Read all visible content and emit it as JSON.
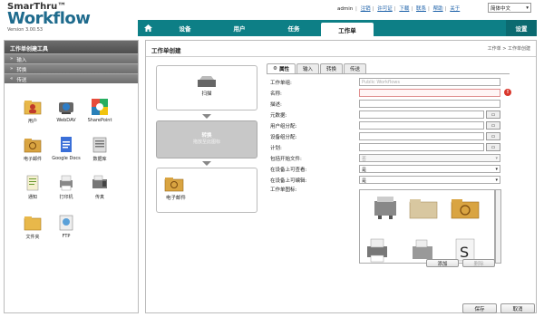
{
  "header": {
    "logo_line1": "SmarThru™",
    "logo_line2": "Workflow",
    "version": "Version 3.00.53",
    "user": "admin",
    "links": [
      "注销",
      "许可证",
      "下载",
      "联系",
      "帮助",
      "关于"
    ],
    "language": "简体中文"
  },
  "nav": {
    "items": [
      "设备",
      "用户",
      "任务",
      "工作单"
    ],
    "active": "工作单",
    "settings": "设置"
  },
  "left_panel": {
    "title": "工作单创建工具",
    "sections": [
      "输入",
      "转换",
      "传送"
    ],
    "tools": [
      {
        "label": "用户",
        "icon": "user-folder-icon"
      },
      {
        "label": "WebDAV",
        "icon": "webdav-icon"
      },
      {
        "label": "SharePoint",
        "icon": "sharepoint-icon"
      },
      {
        "label": "电子邮件",
        "icon": "email-icon"
      },
      {
        "label": "Google Docs",
        "icon": "google-docs-icon"
      },
      {
        "label": "数据库",
        "icon": "database-icon"
      },
      {
        "label": "通知",
        "icon": "notification-icon"
      },
      {
        "label": "打印机",
        "icon": "printer-icon"
      },
      {
        "label": "传真",
        "icon": "fax-icon"
      },
      {
        "label": "文件夹",
        "icon": "folder-icon"
      },
      {
        "label": "FTP",
        "icon": "ftp-icon"
      }
    ]
  },
  "main": {
    "title": "工作单创建",
    "breadcrumb": "工作单 > 工作单创建",
    "flow": {
      "input_label": "扫描",
      "convert_label": "转换",
      "convert_hint": "拖放至此图标",
      "output_label": "电子邮件"
    },
    "tabs": [
      "属性",
      "输入",
      "转换",
      "传送"
    ],
    "form": {
      "workflow_label": "工作单组:",
      "workflow_value": "Public Workflows",
      "name_label": "名称:",
      "desc_label": "描述:",
      "meta_label": "元数据:",
      "user_group_label": "用户组分配:",
      "device_group_label": "设备组分配:",
      "schedule_label": "计划:",
      "include_start_label": "包括开始文件:",
      "include_start_value": "否",
      "show_on_device_label": "在设备上可查看:",
      "show_on_device_value": "是",
      "edit_on_device_label": "在设备上可编辑:",
      "edit_on_device_value": "是",
      "icon_label": "工作单图标:",
      "add_button": "添加",
      "delete_button": "删除"
    },
    "save_button": "保存",
    "cancel_button": "取消"
  },
  "colors": {
    "nav": "#0d7f86",
    "brand_text": "#1f6b8d",
    "panel_header": "#555555"
  }
}
